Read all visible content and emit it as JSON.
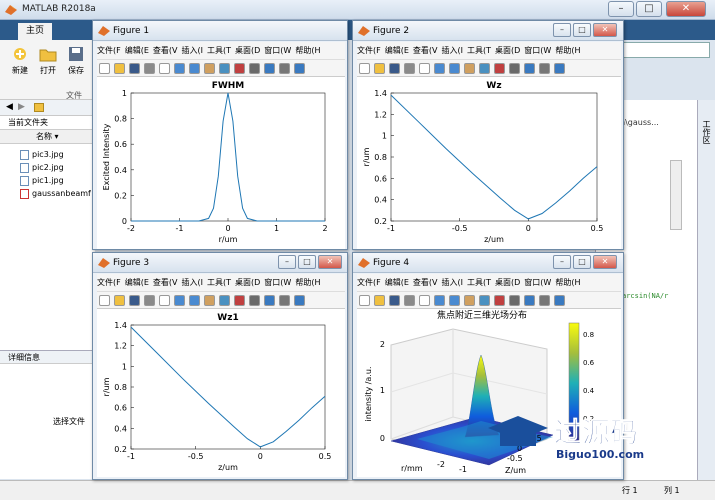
{
  "app": {
    "title": "MATLAB R2018a",
    "tabs": [
      "主页"
    ],
    "search_placeholder": "",
    "ribbon": {
      "new_label": "新建",
      "open_label": "打开",
      "save_label": "保存",
      "group_label": "文件"
    },
    "current_folder_label": "当前文件夹",
    "name_column": "名称",
    "files": [
      "pic3.jpg",
      "pic2.jpg",
      "pic1.jpg",
      "gaussanbeamf"
    ],
    "details_label": "详细信息",
    "select_file_text": "选择文件",
    "right_path_text": "n\\gauss...",
    "right_code_text": "arcsin(NA/r",
    "workspace_tab": "工作区",
    "status_row": "行 1",
    "status_col": "列 1",
    "colors": {
      "accent": "#2c5a8a",
      "line": "#1f77b4"
    }
  },
  "figure_menu": [
    "文件(F",
    "编辑(E",
    "查看(V",
    "插入(I",
    "工具(T",
    "桌面(D",
    "窗口(W",
    "帮助(H"
  ],
  "figures": [
    {
      "title": "Figure 1",
      "axes_title": "FWHM",
      "xlabel": "r/um",
      "ylabel": "Excited Intensity"
    },
    {
      "title": "Figure 2",
      "axes_title": "Wz",
      "xlabel": "z/um",
      "ylabel": "r/um"
    },
    {
      "title": "Figure 3",
      "axes_title": "Wz1",
      "xlabel": "z/um",
      "ylabel": "r/um"
    },
    {
      "title": "Figure 4",
      "axes_title": "焦点附近三维光场分布",
      "xlabel": "r/mm",
      "ylabel": "Z/um",
      "zlabel": "intensity /a.u."
    }
  ],
  "watermark": {
    "text": "过源码",
    "sub": "Biguo100.com"
  },
  "chart_data": [
    {
      "type": "line",
      "title": "FWHM",
      "xlabel": "r/um",
      "ylabel": "Excited Intensity",
      "xlim": [
        -2,
        2
      ],
      "ylim": [
        0,
        1
      ],
      "xticks": [
        -2,
        -1,
        0,
        1,
        2
      ],
      "yticks": [
        0,
        0.2,
        0.4,
        0.6,
        0.8,
        1
      ],
      "series": [
        {
          "x": [
            -2,
            -0.6,
            -0.4,
            -0.3,
            -0.2,
            -0.1,
            0,
            0.1,
            0.2,
            0.3,
            0.4,
            0.6,
            2
          ],
          "y": [
            0,
            0,
            0.02,
            0.1,
            0.35,
            0.78,
            1,
            0.78,
            0.35,
            0.1,
            0.02,
            0,
            0
          ]
        }
      ]
    },
    {
      "type": "line",
      "title": "Wz",
      "xlabel": "z/um",
      "ylabel": "r/um",
      "xlim": [
        -1,
        0.5
      ],
      "ylim": [
        0.2,
        1.4
      ],
      "xticks": [
        -1,
        -0.5,
        0,
        0.5
      ],
      "yticks": [
        0.2,
        0.4,
        0.6,
        0.8,
        1,
        1.2,
        1.4
      ],
      "series": [
        {
          "x": [
            -1,
            -0.8,
            -0.6,
            -0.4,
            -0.2,
            -0.1,
            0,
            0.1,
            0.2,
            0.3,
            0.4,
            0.5
          ],
          "y": [
            1.38,
            1.13,
            0.88,
            0.64,
            0.41,
            0.3,
            0.22,
            0.27,
            0.37,
            0.48,
            0.6,
            0.71
          ]
        }
      ]
    },
    {
      "type": "line",
      "title": "Wz1",
      "xlabel": "z/um",
      "ylabel": "r/um",
      "xlim": [
        -1,
        0.5
      ],
      "ylim": [
        0.2,
        1.4
      ],
      "xticks": [
        -1,
        -0.5,
        0,
        0.5
      ],
      "yticks": [
        0.2,
        0.4,
        0.6,
        0.8,
        1,
        1.2,
        1.4
      ],
      "series": [
        {
          "x": [
            -1,
            -0.8,
            -0.6,
            -0.4,
            -0.2,
            -0.1,
            0,
            0.1,
            0.2,
            0.3,
            0.4,
            0.5
          ],
          "y": [
            1.38,
            1.13,
            0.88,
            0.64,
            0.41,
            0.3,
            0.22,
            0.27,
            0.37,
            0.48,
            0.6,
            0.71
          ]
        }
      ]
    },
    {
      "type": "surface",
      "title": "焦点附近三维光场分布",
      "xlabel": "r/mm",
      "ylabel": "Z/um",
      "zlabel": "intensity /a.u.",
      "zticks": [
        0,
        1,
        2
      ],
      "yticks": [
        -2,
        -1
      ],
      "xticks": [
        -1,
        -0.5,
        0,
        0.5
      ],
      "colorbar_ticks": [
        0.2,
        0.4,
        0.6,
        0.8
      ],
      "colormap": "parula"
    }
  ]
}
